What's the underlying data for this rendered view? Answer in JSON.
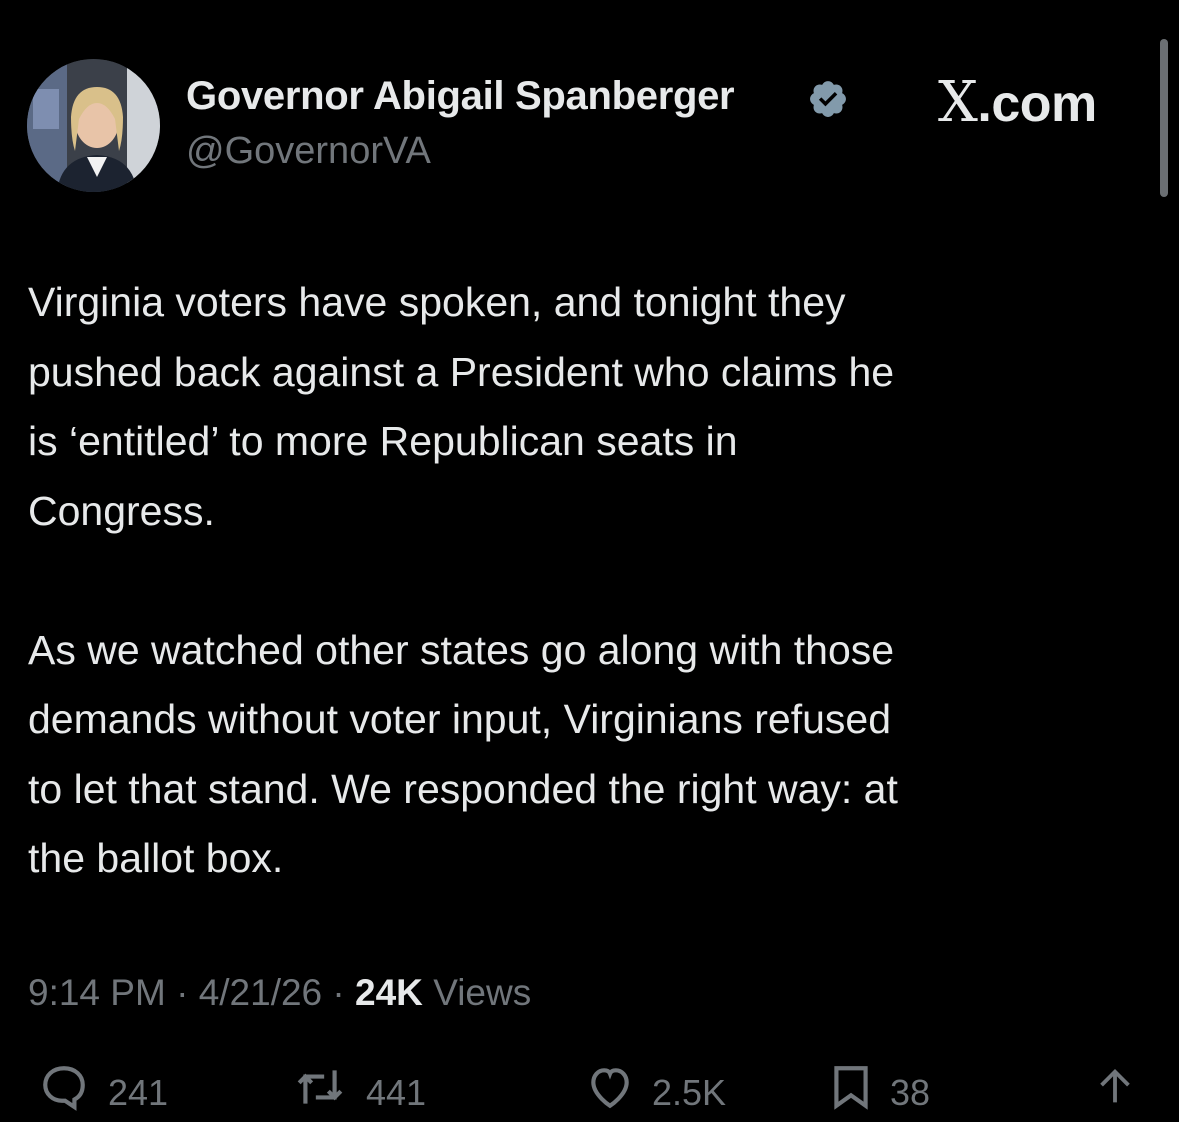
{
  "app": {
    "brand_text": "com",
    "brand_glyph": "X",
    "brand_dot": "."
  },
  "author": {
    "display_name": "Governor Abigail Spanberger",
    "handle": "@GovernorVA",
    "verified": true,
    "avatar_icon": "profile-photo"
  },
  "tweet": {
    "paragraphs": [
      "Virginia voters have spoken, and tonight they\npushed back against a President who claims he\nis ‘entitled’ to more Republican seats in\nCongress.",
      "As we watched other states go along with those\ndemands without voter input, Virginians refused\nto let that stand. We responded the right way: at\nthe ballot box."
    ],
    "time": "9:14 PM",
    "date": "4/21/26",
    "separator": " · ",
    "views_count": "24K",
    "views_label": " Views"
  },
  "actions": {
    "replies": "241",
    "reposts": "441",
    "likes": "2.5K",
    "bookmarks": "38"
  },
  "colors": {
    "background": "#000000",
    "primary_text": "#e7e9ea",
    "secondary_text": "#71767b",
    "verified_badge": "#829aab"
  }
}
